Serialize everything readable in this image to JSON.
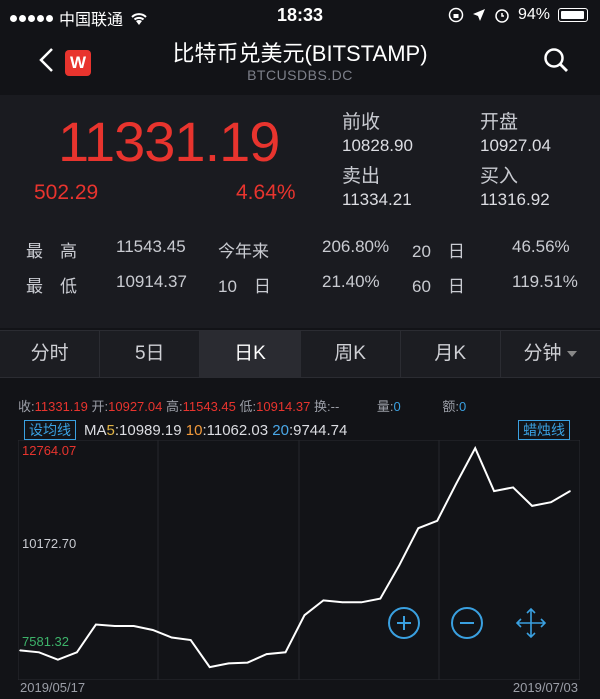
{
  "status": {
    "carrier": "中国联通",
    "time": "18:33",
    "battery": "94%"
  },
  "nav": {
    "title": "比特币兑美元(BITSTAMP)",
    "code": "BTCUSDBS.DC",
    "logo": "W"
  },
  "quote": {
    "price": "11331.19",
    "change": "502.29",
    "change_pct": "4.64%",
    "prev_close_label": "前收",
    "prev_close": "10828.90",
    "open_label": "开盘",
    "open": "10927.04",
    "sell_label": "卖出",
    "sell": "11334.21",
    "buy_label": "买入",
    "buy": "11316.92"
  },
  "stats": {
    "high_label": "最　高",
    "high": "11543.45",
    "ytd_label": "今年来",
    "ytd": "206.80%",
    "d20_label": "20　日",
    "d20": "46.56%",
    "low_label": "最　低",
    "low": "10914.37",
    "d10_label": "10　日",
    "d10": "21.40%",
    "d60_label": "60　日",
    "d60": "119.51%"
  },
  "tabs": [
    "分时",
    "5日",
    "日K",
    "周K",
    "月K",
    "分钟"
  ],
  "active_tab": "日K",
  "info": {
    "close_label": "收:",
    "close": "11331.19",
    "open_label": "开:",
    "open": "10927.04",
    "high_label": "高:",
    "high": "11543.45",
    "low_label": "低:",
    "low": "10914.37",
    "turnover_label": "换:",
    "turnover": "--",
    "volume_label": "量:",
    "volume": "0",
    "amount_label": "额:",
    "amount": "0"
  },
  "ma": {
    "chip": "设均线",
    "ma_label": "MA",
    "ma5_label": "5",
    "ma5": "10989.19",
    "ma10_label": "10",
    "ma10": "11062.03",
    "ma20_label": "20",
    "ma20": "9744.74",
    "candle_chip": "蜡烛线"
  },
  "chart_data": {
    "type": "line",
    "x_start": "2019/05/17",
    "x_end": "2019/07/03",
    "y_labels": [
      "12764.07",
      "10172.70",
      "7581.32"
    ],
    "y_range": [
      7581.32,
      12764.07
    ],
    "values": [
      7300,
      7250,
      7050,
      7250,
      8000,
      7960,
      7960,
      7850,
      7650,
      7580,
      6850,
      6950,
      6970,
      7200,
      7250,
      8250,
      8650,
      8600,
      8600,
      8700,
      9600,
      10600,
      10800,
      11800,
      12760,
      11600,
      11700,
      11200,
      11300,
      11600
    ],
    "line_color": "#ffffff"
  },
  "colors": {
    "up": "#e8342e",
    "accent": "#3aa0e0",
    "bg": "#121317"
  },
  "icons": {
    "zoom_in": "plus-circle-icon",
    "zoom_out": "minus-circle-icon",
    "fullscreen": "expand-arrows-icon"
  }
}
